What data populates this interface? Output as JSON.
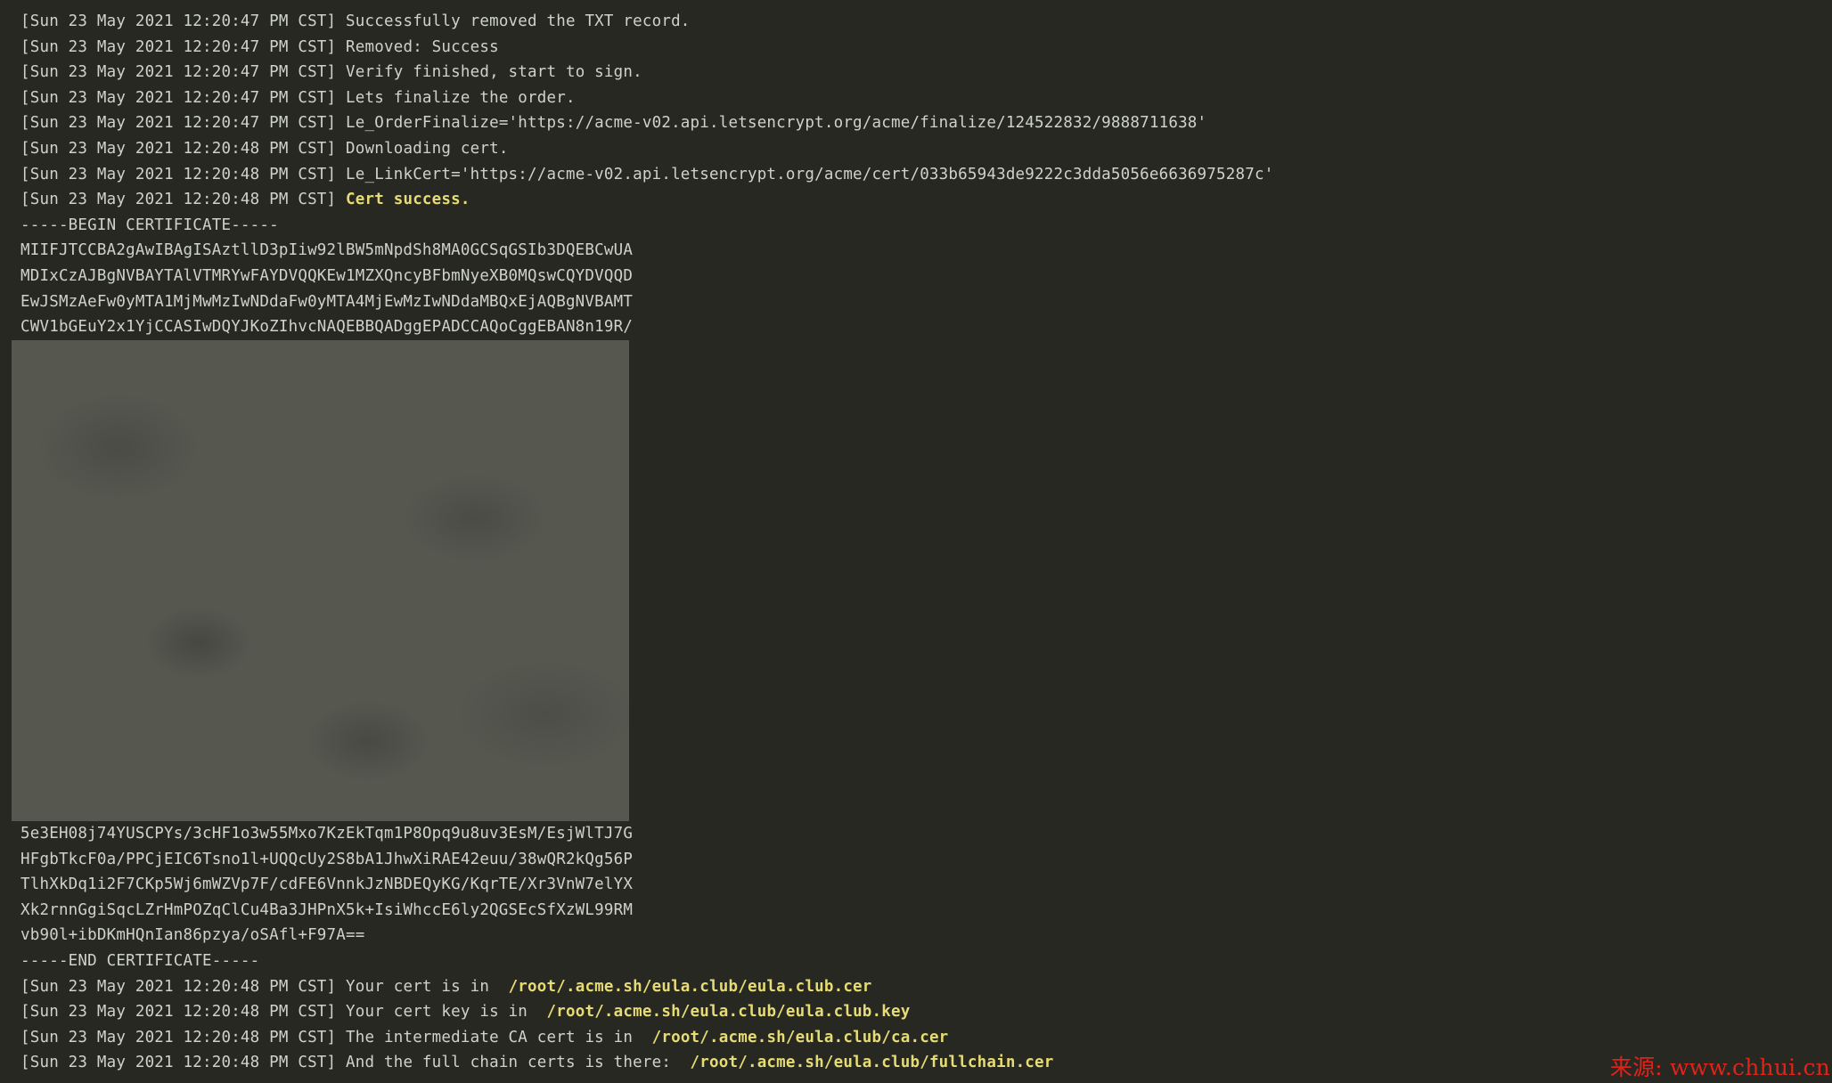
{
  "top_lines": [
    {
      "ts": "[Sun 23 May 2021 12:20:47 PM CST]",
      "msg": "Successfully removed the TXT record."
    },
    {
      "ts": "[Sun 23 May 2021 12:20:47 PM CST]",
      "msg": "Removed: Success"
    },
    {
      "ts": "[Sun 23 May 2021 12:20:47 PM CST]",
      "msg": "Verify finished, start to sign."
    },
    {
      "ts": "[Sun 23 May 2021 12:20:47 PM CST]",
      "msg": "Lets finalize the order."
    },
    {
      "ts": "[Sun 23 May 2021 12:20:47 PM CST]",
      "msg": "Le_OrderFinalize='https://acme-v02.api.letsencrypt.org/acme/finalize/124522832/9888711638'"
    },
    {
      "ts": "[Sun 23 May 2021 12:20:48 PM CST]",
      "msg": "Downloading cert."
    },
    {
      "ts": "[Sun 23 May 2021 12:20:48 PM CST]",
      "msg": "Le_LinkCert='https://acme-v02.api.letsencrypt.org/acme/cert/033b65943de9222c3dda5056e6636975287c'"
    },
    {
      "ts": "[Sun 23 May 2021 12:20:48 PM CST]",
      "highlight": "Cert success."
    }
  ],
  "cert_begin": "-----BEGIN CERTIFICATE-----",
  "cert_head": [
    "MIIFJTCCBA2gAwIBAgISAztllD3pIiw92lBW5mNpdSh8MA0GCSqGSIb3DQEBCwUA",
    "MDIxCzAJBgNVBAYTAlVTMRYwFAYDVQQKEw1MZXQncyBFbmNyeXB0MQswCQYDVQQD",
    "EwJSMzAeFw0yMTA1MjMwMzIwNDdaFw0yMTA4MjEwMzIwNDdaMBQxEjAQBgNVBAMT",
    "CWV1bGEuY2x1YjCCASIwDQYJKoZIhvcNAQEBBQADggEPADCCAQoCggEBAN8n19R/"
  ],
  "cert_tail": [
    "5e3EH08j74YUSCPYs/3cHF1o3w55Mxo7KzEkTqm1P8Opq9u8uv3EsM/EsjWlTJ7G",
    "HFgbTkcF0a/PPCjEIC6Tsno1l+UQQcUy2S8bA1JhwXiRAE42euu/38wQR2kQg56P",
    "TlhXkDq1i2F7CKp5Wj6mWZVp7F/cdFE6VnnkJzNBDEQyKG/KqrTE/Xr3VnW7elYX",
    "Xk2rnnGgiSqcLZrHmPOZqClCu4Ba3JHPnX5k+IsiWhccE6ly2QGSEcSfXzWL99RM",
    "vb90l+ibDKmHQnIan86pzya/oSAfl+F97A=="
  ],
  "cert_end": "-----END CERTIFICATE-----",
  "bottom_lines": [
    {
      "ts": "[Sun 23 May 2021 12:20:48 PM CST]",
      "msg": "Your cert is in  ",
      "path": "/root/.acme.sh/eula.club/eula.club.cer"
    },
    {
      "ts": "[Sun 23 May 2021 12:20:48 PM CST]",
      "msg": "Your cert key is in  ",
      "path": "/root/.acme.sh/eula.club/eula.club.key"
    },
    {
      "ts": "[Sun 23 May 2021 12:20:48 PM CST]",
      "msg": "The intermediate CA cert is in  ",
      "path": "/root/.acme.sh/eula.club/ca.cer"
    },
    {
      "ts": "[Sun 23 May 2021 12:20:48 PM CST]",
      "msg": "And the full chain certs is there:  ",
      "path": "/root/.acme.sh/eula.club/fullchain.cer"
    }
  ],
  "watermark": "来源: www.chhui.cn"
}
